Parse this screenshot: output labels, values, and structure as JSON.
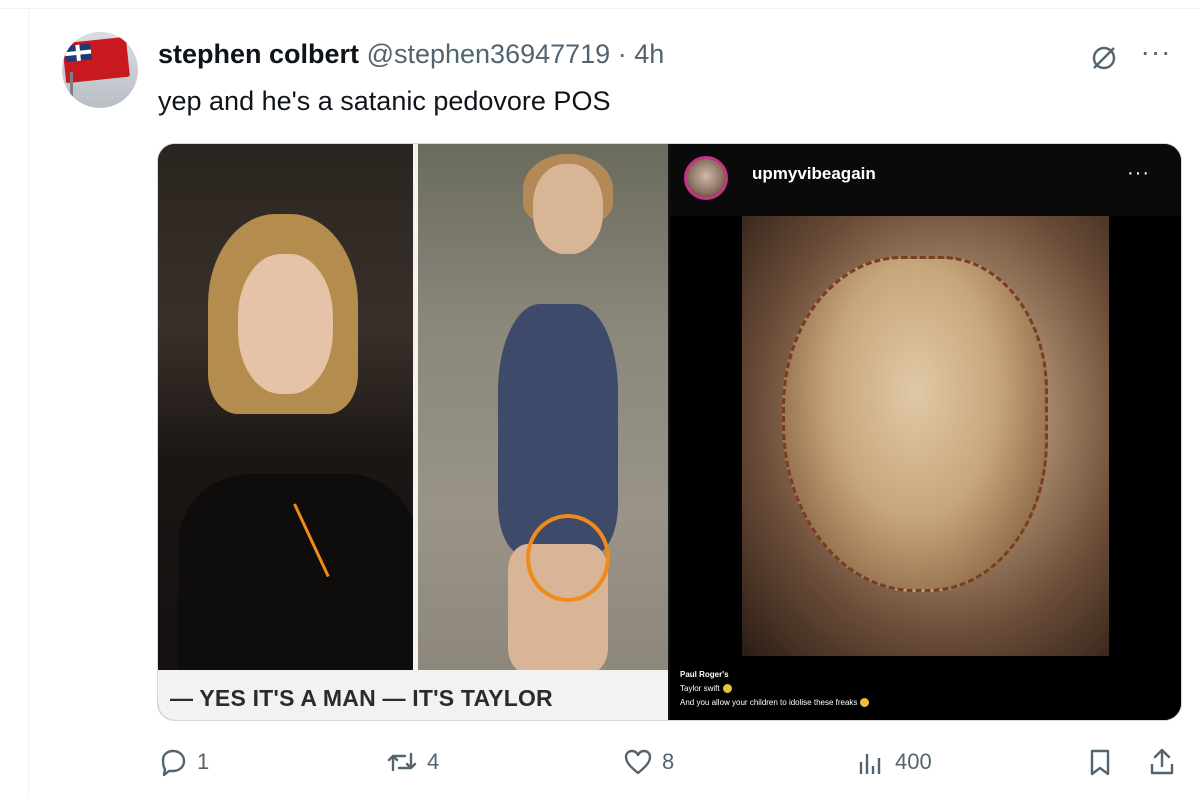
{
  "tweet": {
    "display_name": "stephen colbert",
    "handle": "@stephen36947719",
    "separator": "·",
    "time": "4h",
    "text": "yep and he's a satanic pedovore POS",
    "more_label": "···"
  },
  "media": {
    "collage_caption": "— YES IT'S A MAN — IT'S TAYLOR",
    "instagram": {
      "username": "upmyvibeagain",
      "more_label": "···",
      "caption_author": "Paul Roger's",
      "caption_line1": "Taylor swift",
      "caption_line2": "And you allow your children to idolise these freaks"
    }
  },
  "actions": {
    "replies": "1",
    "reposts": "4",
    "likes": "8",
    "views": "400"
  },
  "colors": {
    "text_primary": "#0f1419",
    "text_secondary": "#536471",
    "border": "#cfd9de",
    "highlight": "#f08a1a"
  }
}
